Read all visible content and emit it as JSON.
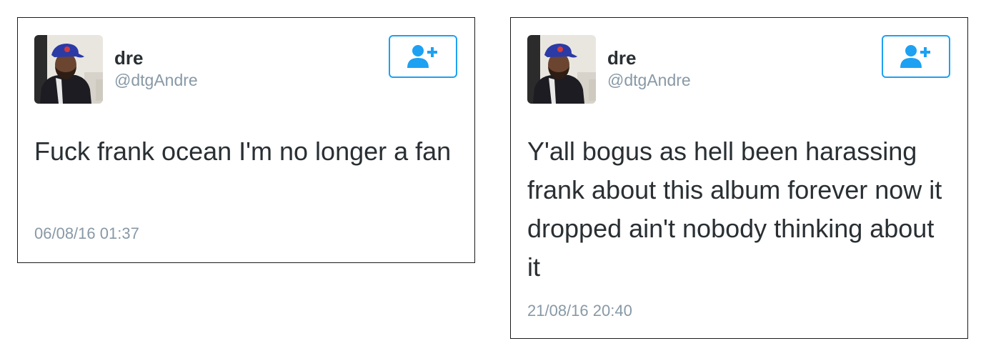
{
  "icons": {
    "avatar": "avatar-photo",
    "follow": "add-user-icon"
  },
  "colors": {
    "accent": "#1da1f2",
    "text": "#292f33",
    "muted": "#8899a6",
    "border": "#1a1a1a"
  },
  "tweets": [
    {
      "display_name": "dre",
      "handle": "@dtgAndre",
      "text": "Fuck frank ocean I'm no longer a fan",
      "timestamp": "06/08/16 01:37"
    },
    {
      "display_name": "dre",
      "handle": "@dtgAndre",
      "text": "Y'all bogus as hell been harassing frank about this album forever now it dropped ain't nobody thinking about it",
      "timestamp": "21/08/16 20:40"
    }
  ]
}
